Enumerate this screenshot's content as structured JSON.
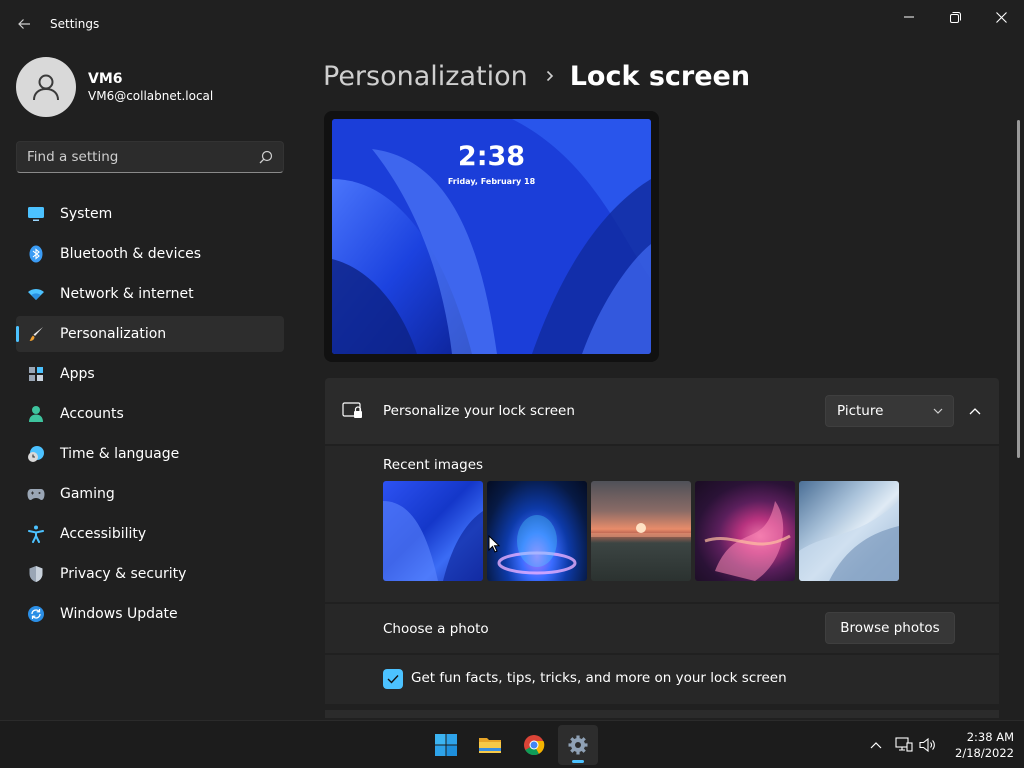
{
  "app": {
    "title": "Settings"
  },
  "profile": {
    "name": "VM6",
    "email": "VM6@collabnet.local"
  },
  "search": {
    "placeholder": "Find a setting"
  },
  "nav": {
    "items": [
      {
        "label": "System",
        "icon": "monitor-icon"
      },
      {
        "label": "Bluetooth & devices",
        "icon": "bluetooth-icon"
      },
      {
        "label": "Network & internet",
        "icon": "wifi-icon"
      },
      {
        "label": "Personalization",
        "icon": "brush-icon",
        "active": true
      },
      {
        "label": "Apps",
        "icon": "apps-icon"
      },
      {
        "label": "Accounts",
        "icon": "person-icon"
      },
      {
        "label": "Time & language",
        "icon": "globe-clock-icon"
      },
      {
        "label": "Gaming",
        "icon": "gamepad-icon"
      },
      {
        "label": "Accessibility",
        "icon": "accessibility-icon"
      },
      {
        "label": "Privacy & security",
        "icon": "shield-icon"
      },
      {
        "label": "Windows Update",
        "icon": "update-icon"
      }
    ]
  },
  "breadcrumb": {
    "parent": "Personalization",
    "current": "Lock screen"
  },
  "preview": {
    "time": "2:38",
    "date": "Friday, February 18"
  },
  "lock_screen": {
    "personalize_label": "Personalize your lock screen",
    "dropdown_value": "Picture",
    "recent_images_label": "Recent images",
    "choose_photo_label": "Choose a photo",
    "browse_button": "Browse photos",
    "tips_checkbox_label": "Get fun facts, tips, tricks, and more on your lock screen",
    "tips_checked": true
  },
  "taskbar": {
    "clock_time": "2:38 AM",
    "clock_date": "2/18/2022"
  },
  "colors": {
    "accent": "#4cc2ff",
    "background": "#202020",
    "card": "#2b2b2b"
  }
}
